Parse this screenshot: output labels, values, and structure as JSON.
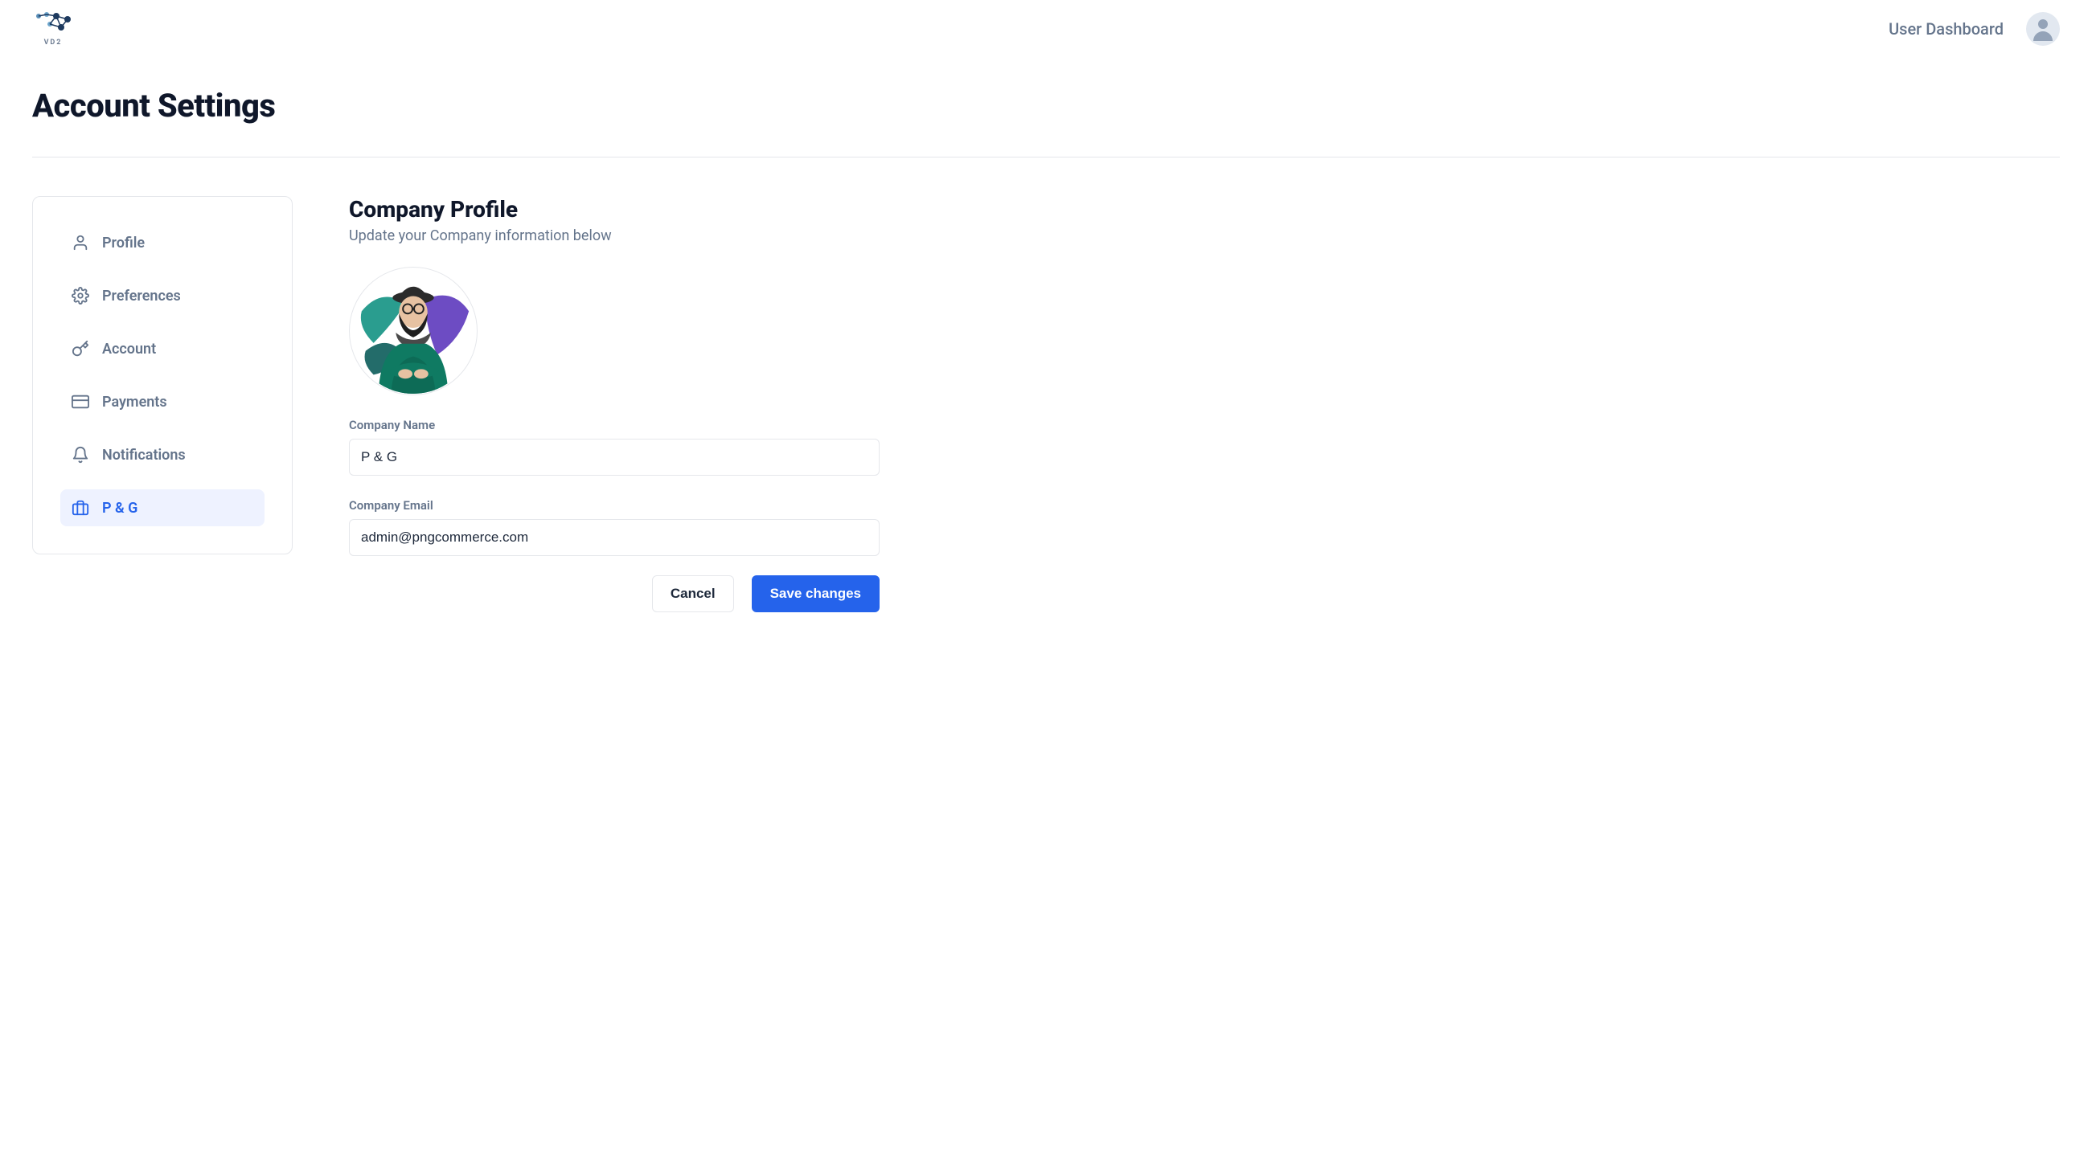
{
  "header": {
    "logo_text": "VD2",
    "dashboard_link": "User Dashboard"
  },
  "page": {
    "title": "Account Settings"
  },
  "sidebar": {
    "items": [
      {
        "icon": "user-icon",
        "label": "Profile",
        "active": false
      },
      {
        "icon": "gear-icon",
        "label": "Preferences",
        "active": false
      },
      {
        "icon": "key-icon",
        "label": "Account",
        "active": false
      },
      {
        "icon": "card-icon",
        "label": "Payments",
        "active": false
      },
      {
        "icon": "bell-icon",
        "label": "Notifications",
        "active": false
      },
      {
        "icon": "briefcase-icon",
        "label": "P & G",
        "active": true
      }
    ]
  },
  "content": {
    "section_title": "Company Profile",
    "section_subtitle": "Update your Company information below",
    "fields": {
      "company_name": {
        "label": "Company Name",
        "value": "P & G"
      },
      "company_email": {
        "label": "Company Email",
        "value": "admin@pngcommerce.com"
      }
    },
    "actions": {
      "cancel": "Cancel",
      "save": "Save changes"
    }
  }
}
